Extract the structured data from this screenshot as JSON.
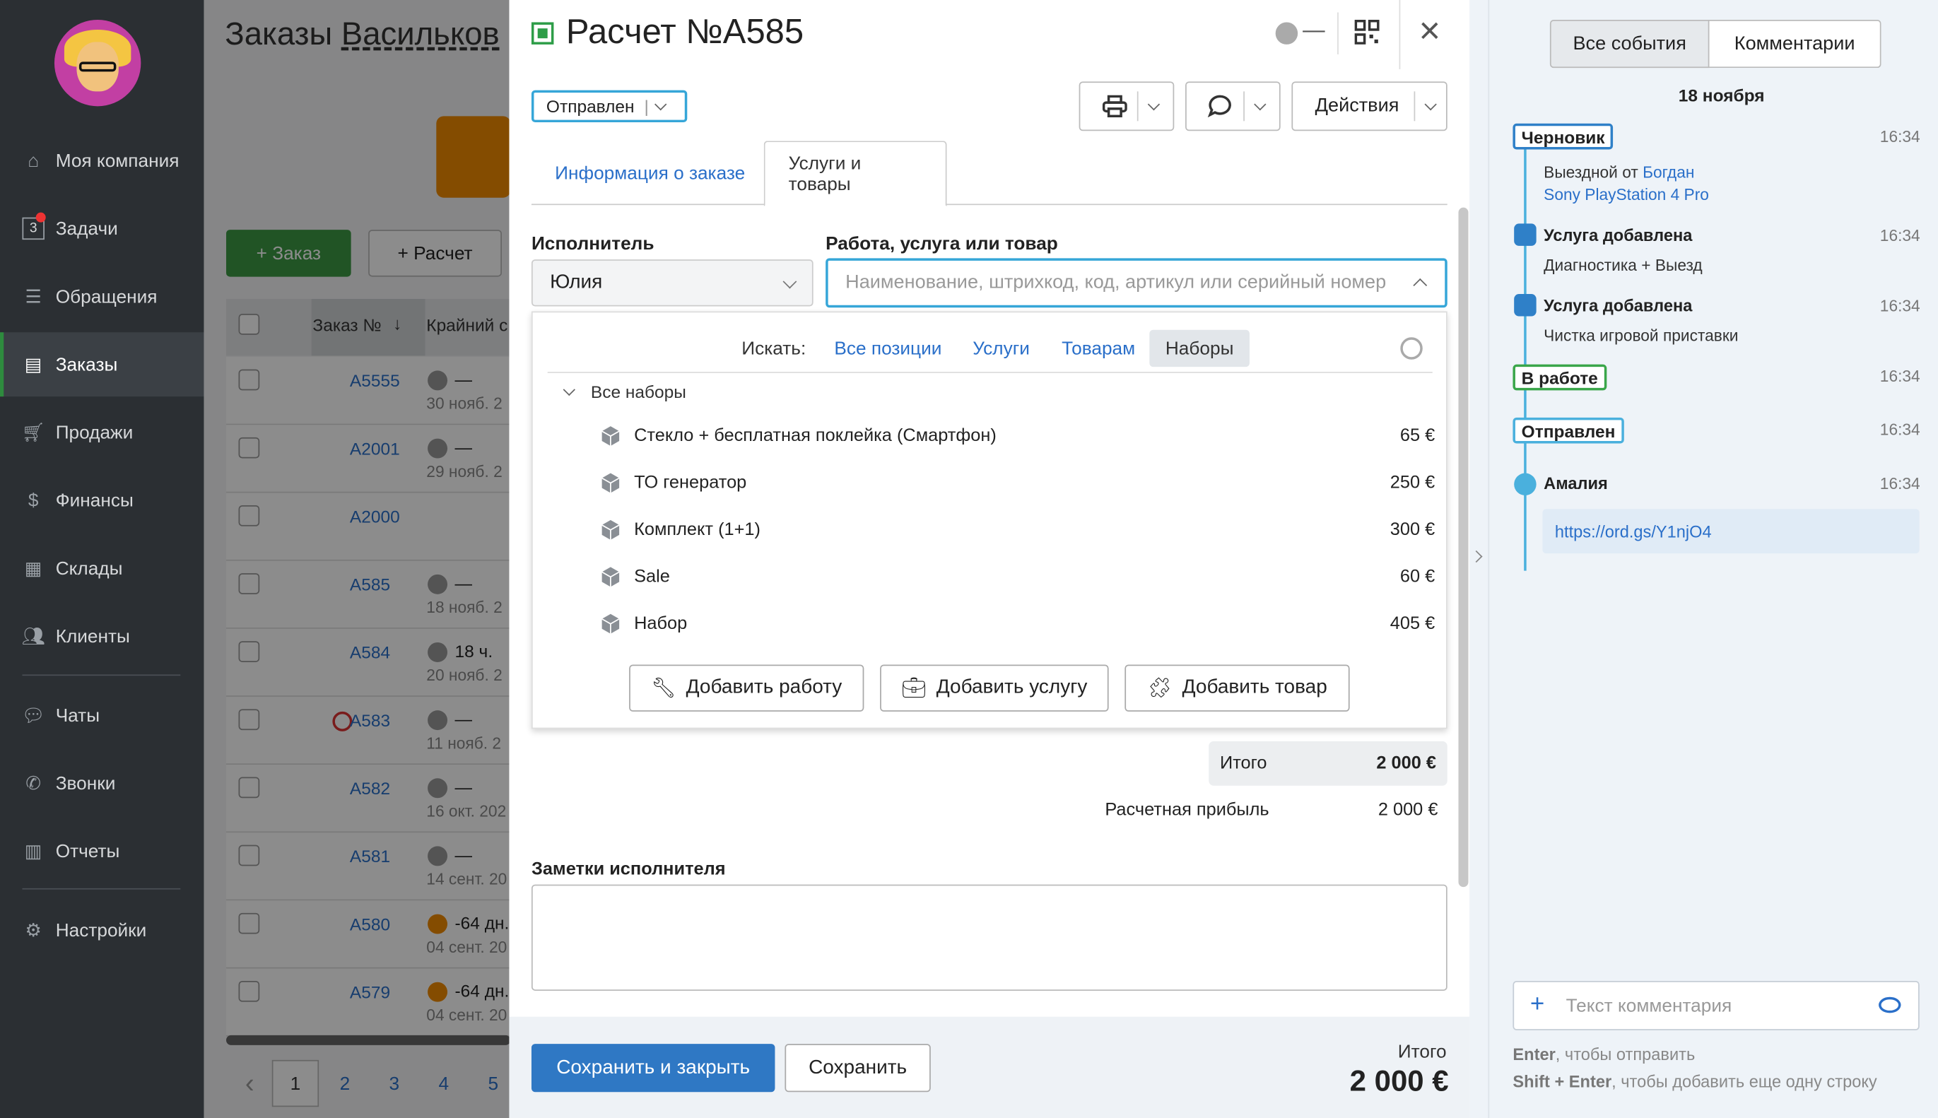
{
  "sidebar": {
    "items": [
      {
        "label": "Моя компания",
        "icon": "home-icon"
      },
      {
        "label": "Задачи",
        "icon": "tasks-icon",
        "badge": "3"
      },
      {
        "label": "Обращения",
        "icon": "inbox-icon"
      },
      {
        "label": "Заказы",
        "icon": "orders-icon",
        "active": true
      },
      {
        "label": "Продажи",
        "icon": "cart-icon"
      },
      {
        "label": "Финансы",
        "icon": "coin-icon"
      },
      {
        "label": "Склады",
        "icon": "warehouse-icon"
      },
      {
        "label": "Клиенты",
        "icon": "users-icon"
      },
      {
        "label": "Чаты",
        "icon": "chat-icon"
      },
      {
        "label": "Звонки",
        "icon": "phone-icon"
      },
      {
        "label": "Отчеты",
        "icon": "reports-icon"
      },
      {
        "label": "Настройки",
        "icon": "gear-icon"
      }
    ]
  },
  "background": {
    "title_a": "Заказы",
    "title_b": "Васильков",
    "btn_order": "+ Заказ",
    "btn_calc": "+ Расчет",
    "col_order": "Заказ №",
    "col_deadline": "Крайний с",
    "rows": [
      {
        "num": "A5555",
        "t1": "—",
        "t2": "30 нояб. 2",
        "clock": "grey"
      },
      {
        "num": "A2001",
        "t1": "—",
        "t2": "29 нояб. 2",
        "clock": "grey"
      },
      {
        "num": "A2000",
        "t1": "",
        "t2": "",
        "clock": "none"
      },
      {
        "num": "A585",
        "t1": "—",
        "t2": "18 нояб. 2",
        "clock": "grey"
      },
      {
        "num": "A584",
        "t1": "18 ч.",
        "t2": "20 нояб. 2",
        "clock": "grey"
      },
      {
        "num": "A583",
        "t1": "—",
        "t2": "11 нояб. 2",
        "clock": "grey"
      },
      {
        "num": "A582",
        "t1": "—",
        "t2": "16 окт. 202",
        "clock": "grey"
      },
      {
        "num": "A581",
        "t1": "—",
        "t2": "14 сент. 20",
        "clock": "grey"
      },
      {
        "num": "A580",
        "t1": "-64 дн.",
        "t2": "04 сент. 20",
        "clock": "orange"
      },
      {
        "num": "A579",
        "t1": "-64 дн.",
        "t2": "04 сент. 20",
        "clock": "orange"
      }
    ],
    "pages": [
      "1",
      "2",
      "3",
      "4",
      "5"
    ]
  },
  "modal": {
    "title": "Расчет №A585",
    "status": "Отправлен",
    "actions_label": "Действия",
    "tabs": [
      "Информация о заказе",
      "Услуги и товары"
    ],
    "executor_label": "Исполнитель",
    "executor_value": "Юлия",
    "work_label": "Работа, услуга или товар",
    "search_placeholder": "Наименование, штрихкод, код, артикул или серийный номер",
    "filter_label": "Искать:",
    "filters": [
      "Все позиции",
      "Услуги",
      "Товарам",
      "Наборы"
    ],
    "group": "Все наборы",
    "items": [
      {
        "name": "Стекло + бесплатная поклейка (Смартфон)",
        "price": "65 €"
      },
      {
        "name": "ТО генератор",
        "price": "250 €"
      },
      {
        "name": "Комплект (1+1)",
        "price": "300 €"
      },
      {
        "name": "Sale",
        "price": "60 €"
      },
      {
        "name": "Набор",
        "price": "405 €"
      }
    ],
    "add_work": "Добавить работу",
    "add_service": "Добавить услугу",
    "add_product": "Добавить товар",
    "total_label": "Итого",
    "total_value": "2 000 €",
    "profit_label": "Расчетная прибыль",
    "profit_value": "2 000 €",
    "notes_label": "Заметки исполнителя",
    "btn_save_close": "Сохранить и закрыть",
    "btn_save": "Сохранить",
    "footer_total_label": "Итого",
    "footer_total_value": "2 000 €"
  },
  "events": {
    "tab_all": "Все события",
    "tab_comments": "Комментарии",
    "date": "18 ноября",
    "e1_status": "Черновик",
    "e1_time": "16:34",
    "e1_from": "Выездной от",
    "e1_author": "Богдан",
    "e1_device": "Sony PlayStation 4 Pro",
    "e2_title": "Услуга добавлена",
    "e2_time": "16:34",
    "e2_text": "Диагностика + Выезд",
    "e3_title": "Услуга добавлена",
    "e3_time": "16:34",
    "e3_text": "Чистка игровой приставки",
    "e4_status": "В работе",
    "e4_time": "16:34",
    "e5_status": "Отправлен",
    "e5_time": "16:34",
    "e6_author": "Амалия",
    "e6_time": "16:34",
    "e6_link": "https://ord.gs/Y1njO4",
    "comment_placeholder": "Текст комментария",
    "hint1_key": "Enter",
    "hint1_text": ", чтобы отправить",
    "hint2_key": "Shift + Enter",
    "hint2_text": ", чтобы добавить еще одну строку"
  }
}
